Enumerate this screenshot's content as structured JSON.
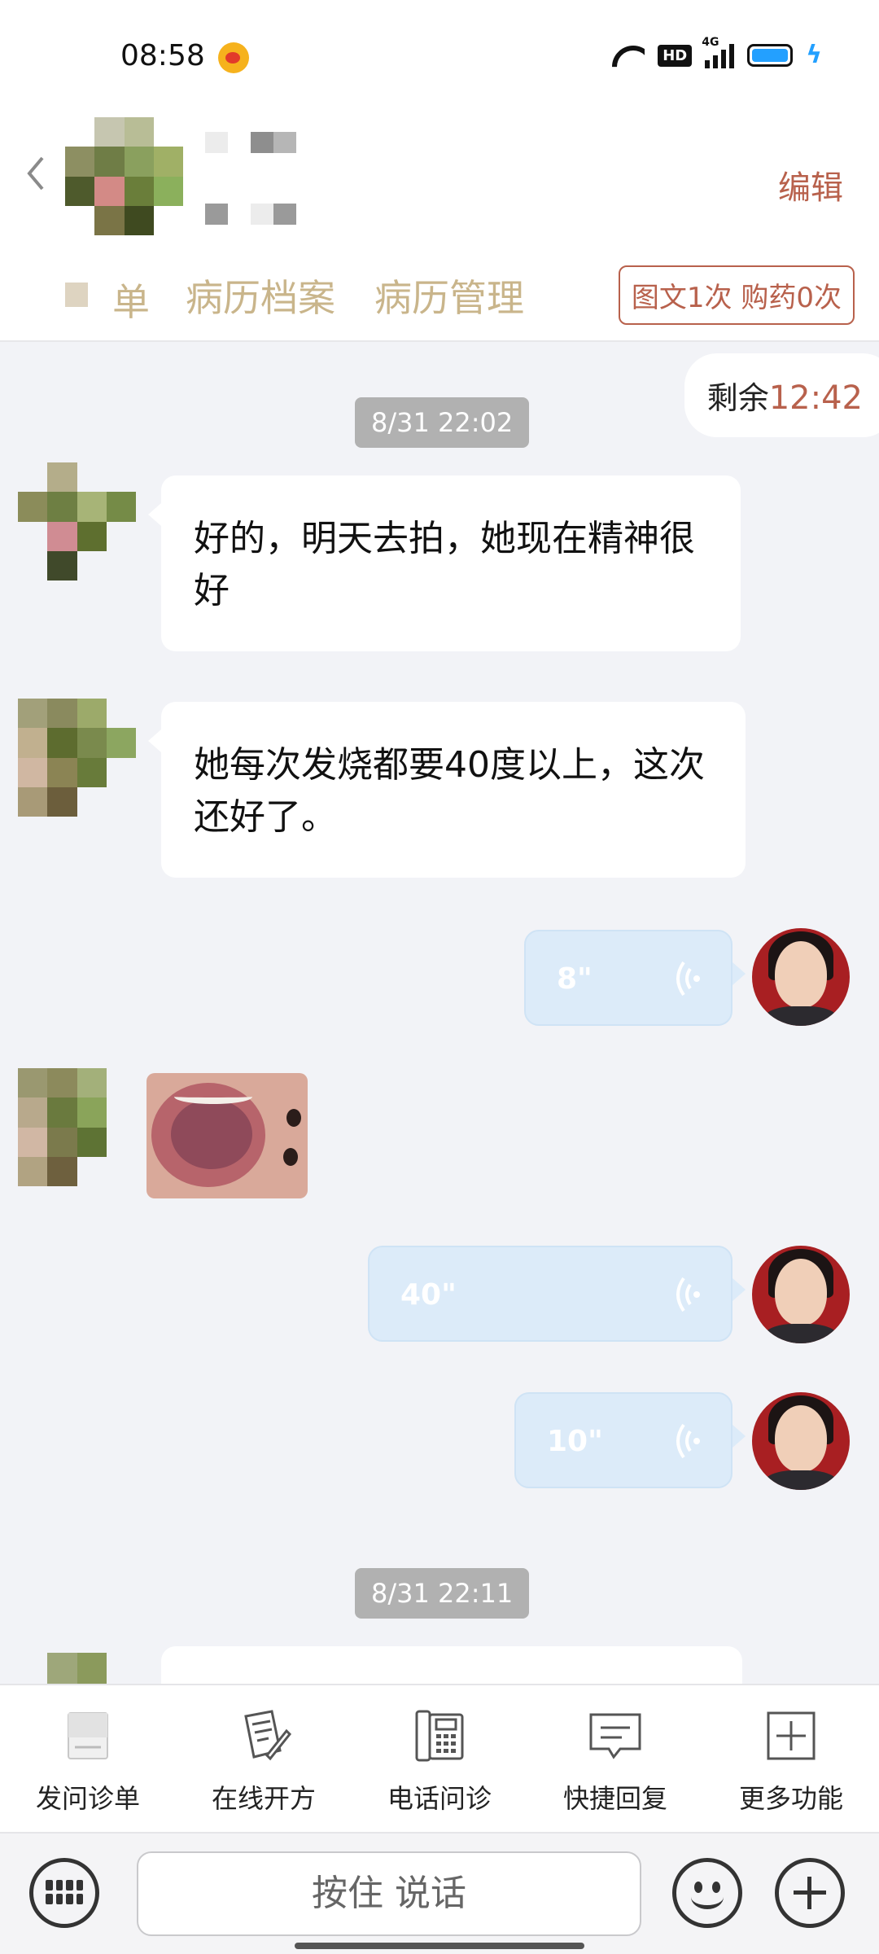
{
  "status_bar": {
    "time": "08:58",
    "network": "4G",
    "hd_label": "HD",
    "battery_color": "#23a0ff"
  },
  "header": {
    "edit_label": "编辑",
    "tabs": [
      {
        "label": "单"
      },
      {
        "label": "病历档案"
      },
      {
        "label": "病历管理"
      }
    ],
    "quota": "图文1次 购药0次",
    "accent": "#b8614c",
    "tab_color": "#c9b58b"
  },
  "timer": {
    "prefix": "剩余",
    "value": "12:42"
  },
  "messages": {
    "timestamp_1": "8/31 22:02",
    "msg_1": "好的，明天去拍，她现在精神很好",
    "msg_2": "她每次发烧都要40度以上，这次还好了。",
    "voice_1": "8\"",
    "voice_2": "40\"",
    "voice_3": "10\"",
    "timestamp_2": "8/31 22:11"
  },
  "toolbar": {
    "items": [
      {
        "label": "发问诊单",
        "icon": "form-icon"
      },
      {
        "label": "在线开方",
        "icon": "prescription-icon"
      },
      {
        "label": "电话问诊",
        "icon": "phone-icon"
      },
      {
        "label": "快捷回复",
        "icon": "quick-reply-icon"
      },
      {
        "label": "更多功能",
        "icon": "more-icon"
      }
    ]
  },
  "input_bar": {
    "hold_to_talk": "按住 说话"
  }
}
